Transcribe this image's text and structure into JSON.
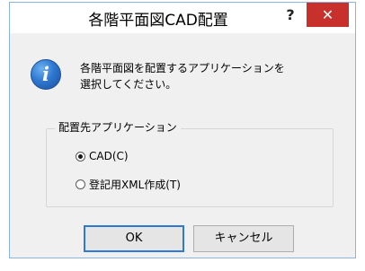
{
  "window": {
    "title": "各階平面図CAD配置",
    "help_label": "?",
    "close_label": "✕"
  },
  "message": {
    "icon": "info-icon",
    "line1": "各階平面図を配置するアプリケーションを",
    "line2": "選択してください。"
  },
  "group": {
    "title": "配置先アプリケーション",
    "options": [
      {
        "label": "CAD(C)",
        "checked": true
      },
      {
        "label": "登記用XML作成(T)",
        "checked": false
      }
    ]
  },
  "buttons": {
    "ok": "OK",
    "cancel": "キャンセル"
  },
  "colors": {
    "close_bg": "#c7302b",
    "ok_border": "#2f78d4",
    "info_icon": "#2e78d2"
  }
}
